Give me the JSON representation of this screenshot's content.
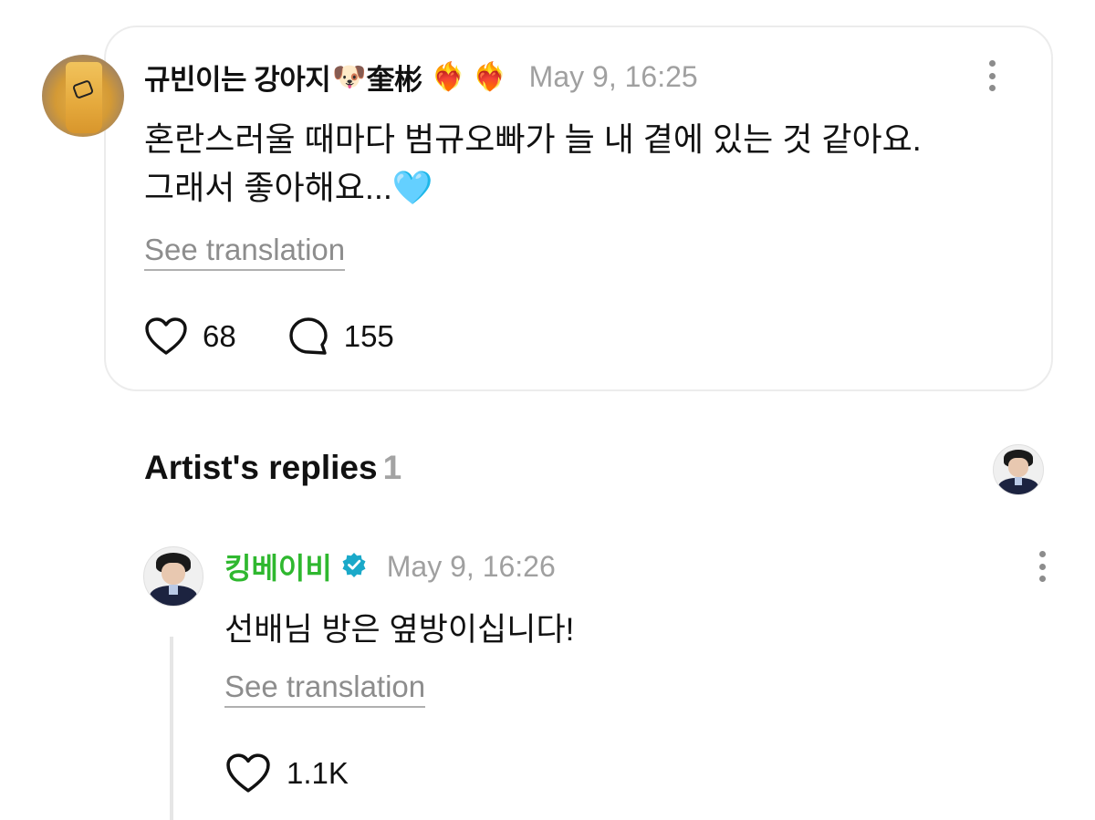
{
  "post": {
    "author": "규빈이는 강아지",
    "author_suffix_emoji": "🐶",
    "author_hanja": "奎彬",
    "author_trailing_emojis": "❤️‍🔥 ❤️‍🔥",
    "date": "May 9, 16:25",
    "body_line1": "혼란스러울 때마다 범규오빠가 늘 내 곁에 있는 것 같아요.",
    "body_line2": "그래서 좋아해요...",
    "body_emoji": "🩵",
    "see_translation": "See translation",
    "likes": "68",
    "comments": "155"
  },
  "replies": {
    "title": "Artist's replies",
    "count": "1"
  },
  "reply": {
    "author": "킹베이비",
    "author_color": "#2fb82f",
    "verified_color": "#1aa9c9",
    "date": "May 9, 16:26",
    "body": "선배님 방은 옆방이십니다!",
    "see_translation": "See translation",
    "likes": "1.1K"
  }
}
